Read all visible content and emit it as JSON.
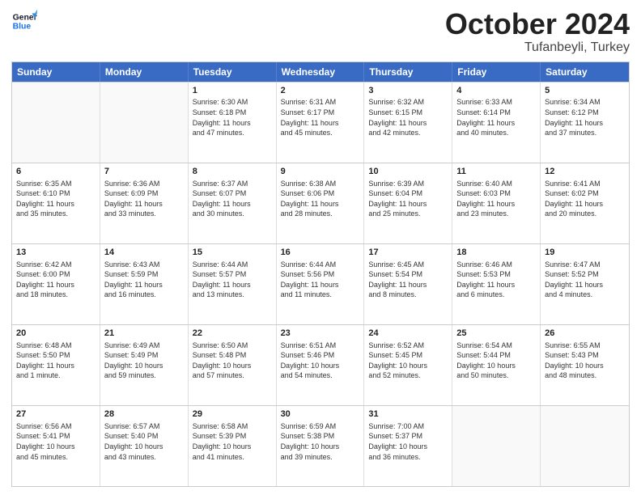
{
  "logo": {
    "line1": "General",
    "line2": "Blue"
  },
  "title": "October 2024",
  "subtitle": "Tufanbeyli, Turkey",
  "days": [
    "Sunday",
    "Monday",
    "Tuesday",
    "Wednesday",
    "Thursday",
    "Friday",
    "Saturday"
  ],
  "weeks": [
    [
      {
        "num": "",
        "lines": [],
        "empty": true
      },
      {
        "num": "",
        "lines": [],
        "empty": true
      },
      {
        "num": "1",
        "lines": [
          "Sunrise: 6:30 AM",
          "Sunset: 6:18 PM",
          "Daylight: 11 hours",
          "and 47 minutes."
        ]
      },
      {
        "num": "2",
        "lines": [
          "Sunrise: 6:31 AM",
          "Sunset: 6:17 PM",
          "Daylight: 11 hours",
          "and 45 minutes."
        ]
      },
      {
        "num": "3",
        "lines": [
          "Sunrise: 6:32 AM",
          "Sunset: 6:15 PM",
          "Daylight: 11 hours",
          "and 42 minutes."
        ]
      },
      {
        "num": "4",
        "lines": [
          "Sunrise: 6:33 AM",
          "Sunset: 6:14 PM",
          "Daylight: 11 hours",
          "and 40 minutes."
        ]
      },
      {
        "num": "5",
        "lines": [
          "Sunrise: 6:34 AM",
          "Sunset: 6:12 PM",
          "Daylight: 11 hours",
          "and 37 minutes."
        ]
      }
    ],
    [
      {
        "num": "6",
        "lines": [
          "Sunrise: 6:35 AM",
          "Sunset: 6:10 PM",
          "Daylight: 11 hours",
          "and 35 minutes."
        ]
      },
      {
        "num": "7",
        "lines": [
          "Sunrise: 6:36 AM",
          "Sunset: 6:09 PM",
          "Daylight: 11 hours",
          "and 33 minutes."
        ]
      },
      {
        "num": "8",
        "lines": [
          "Sunrise: 6:37 AM",
          "Sunset: 6:07 PM",
          "Daylight: 11 hours",
          "and 30 minutes."
        ]
      },
      {
        "num": "9",
        "lines": [
          "Sunrise: 6:38 AM",
          "Sunset: 6:06 PM",
          "Daylight: 11 hours",
          "and 28 minutes."
        ]
      },
      {
        "num": "10",
        "lines": [
          "Sunrise: 6:39 AM",
          "Sunset: 6:04 PM",
          "Daylight: 11 hours",
          "and 25 minutes."
        ]
      },
      {
        "num": "11",
        "lines": [
          "Sunrise: 6:40 AM",
          "Sunset: 6:03 PM",
          "Daylight: 11 hours",
          "and 23 minutes."
        ]
      },
      {
        "num": "12",
        "lines": [
          "Sunrise: 6:41 AM",
          "Sunset: 6:02 PM",
          "Daylight: 11 hours",
          "and 20 minutes."
        ]
      }
    ],
    [
      {
        "num": "13",
        "lines": [
          "Sunrise: 6:42 AM",
          "Sunset: 6:00 PM",
          "Daylight: 11 hours",
          "and 18 minutes."
        ]
      },
      {
        "num": "14",
        "lines": [
          "Sunrise: 6:43 AM",
          "Sunset: 5:59 PM",
          "Daylight: 11 hours",
          "and 16 minutes."
        ]
      },
      {
        "num": "15",
        "lines": [
          "Sunrise: 6:44 AM",
          "Sunset: 5:57 PM",
          "Daylight: 11 hours",
          "and 13 minutes."
        ]
      },
      {
        "num": "16",
        "lines": [
          "Sunrise: 6:44 AM",
          "Sunset: 5:56 PM",
          "Daylight: 11 hours",
          "and 11 minutes."
        ]
      },
      {
        "num": "17",
        "lines": [
          "Sunrise: 6:45 AM",
          "Sunset: 5:54 PM",
          "Daylight: 11 hours",
          "and 8 minutes."
        ]
      },
      {
        "num": "18",
        "lines": [
          "Sunrise: 6:46 AM",
          "Sunset: 5:53 PM",
          "Daylight: 11 hours",
          "and 6 minutes."
        ]
      },
      {
        "num": "19",
        "lines": [
          "Sunrise: 6:47 AM",
          "Sunset: 5:52 PM",
          "Daylight: 11 hours",
          "and 4 minutes."
        ]
      }
    ],
    [
      {
        "num": "20",
        "lines": [
          "Sunrise: 6:48 AM",
          "Sunset: 5:50 PM",
          "Daylight: 11 hours",
          "and 1 minute."
        ]
      },
      {
        "num": "21",
        "lines": [
          "Sunrise: 6:49 AM",
          "Sunset: 5:49 PM",
          "Daylight: 10 hours",
          "and 59 minutes."
        ]
      },
      {
        "num": "22",
        "lines": [
          "Sunrise: 6:50 AM",
          "Sunset: 5:48 PM",
          "Daylight: 10 hours",
          "and 57 minutes."
        ]
      },
      {
        "num": "23",
        "lines": [
          "Sunrise: 6:51 AM",
          "Sunset: 5:46 PM",
          "Daylight: 10 hours",
          "and 54 minutes."
        ]
      },
      {
        "num": "24",
        "lines": [
          "Sunrise: 6:52 AM",
          "Sunset: 5:45 PM",
          "Daylight: 10 hours",
          "and 52 minutes."
        ]
      },
      {
        "num": "25",
        "lines": [
          "Sunrise: 6:54 AM",
          "Sunset: 5:44 PM",
          "Daylight: 10 hours",
          "and 50 minutes."
        ]
      },
      {
        "num": "26",
        "lines": [
          "Sunrise: 6:55 AM",
          "Sunset: 5:43 PM",
          "Daylight: 10 hours",
          "and 48 minutes."
        ]
      }
    ],
    [
      {
        "num": "27",
        "lines": [
          "Sunrise: 6:56 AM",
          "Sunset: 5:41 PM",
          "Daylight: 10 hours",
          "and 45 minutes."
        ]
      },
      {
        "num": "28",
        "lines": [
          "Sunrise: 6:57 AM",
          "Sunset: 5:40 PM",
          "Daylight: 10 hours",
          "and 43 minutes."
        ]
      },
      {
        "num": "29",
        "lines": [
          "Sunrise: 6:58 AM",
          "Sunset: 5:39 PM",
          "Daylight: 10 hours",
          "and 41 minutes."
        ]
      },
      {
        "num": "30",
        "lines": [
          "Sunrise: 6:59 AM",
          "Sunset: 5:38 PM",
          "Daylight: 10 hours",
          "and 39 minutes."
        ]
      },
      {
        "num": "31",
        "lines": [
          "Sunrise: 7:00 AM",
          "Sunset: 5:37 PM",
          "Daylight: 10 hours",
          "and 36 minutes."
        ]
      },
      {
        "num": "",
        "lines": [],
        "empty": true
      },
      {
        "num": "",
        "lines": [],
        "empty": true
      }
    ]
  ]
}
